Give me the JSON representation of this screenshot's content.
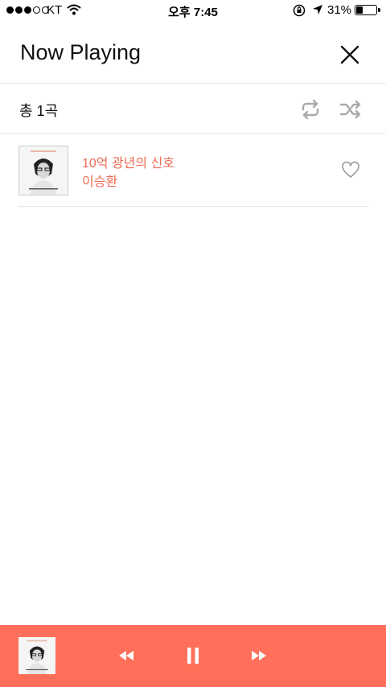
{
  "status_bar": {
    "carrier": "KT",
    "time": "오후 7:45",
    "battery_percent": "31%",
    "battery_level": 0.31
  },
  "header": {
    "title": "Now Playing",
    "close_icon": "close-icon"
  },
  "toolbar": {
    "count_label": "총 1곡",
    "repeat_icon": "repeat-icon",
    "shuffle_icon": "shuffle-icon"
  },
  "tracks": [
    {
      "title": "10억 광년의 신호",
      "artist": "이승환",
      "favorite_icon": "heart-outline-icon"
    }
  ],
  "player": {
    "controls": [
      "rewind-icon",
      "pause-icon",
      "fast-forward-icon"
    ]
  },
  "colors": {
    "accent": "#ff6f5a",
    "track_text": "#ee6a55",
    "icon_gray": "#aaaaaa",
    "divider": "#e6e6e6"
  }
}
